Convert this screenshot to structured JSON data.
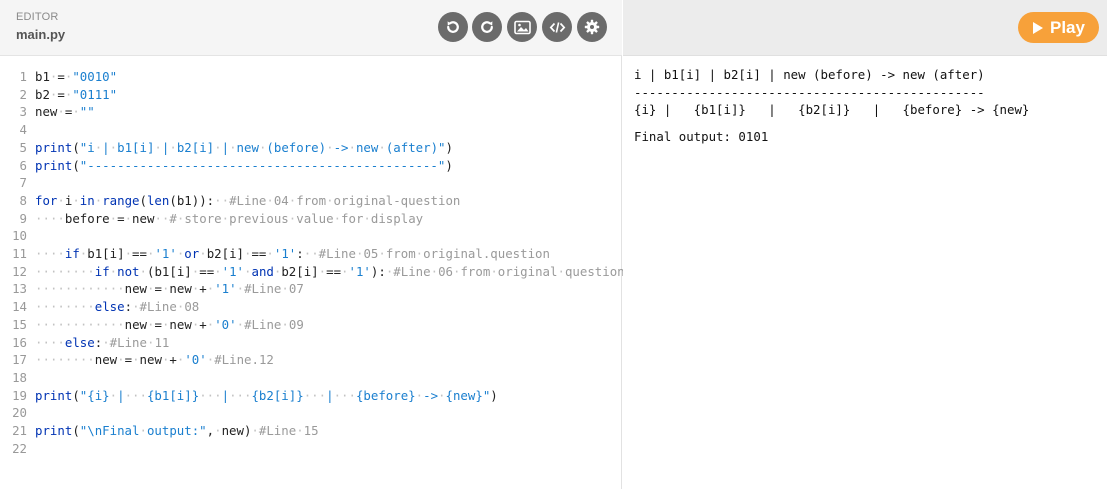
{
  "editor": {
    "label": "EDITOR",
    "file_name": "main.py",
    "toolbar": {
      "buttons": [
        {
          "name": "reset-button",
          "icon": "reset-icon"
        },
        {
          "name": "refresh-button",
          "icon": "refresh-icon"
        },
        {
          "name": "image-button",
          "icon": "image-icon"
        },
        {
          "name": "embed-button",
          "icon": "code-icon"
        },
        {
          "name": "settings-button",
          "icon": "gear-icon"
        }
      ],
      "button_color": "#6b6b6b"
    },
    "lines": [
      {
        "n": "1",
        "text": "b1 = \"0010\""
      },
      {
        "n": "2",
        "text": "b2 = \"0111\""
      },
      {
        "n": "3",
        "text": "new = \"\""
      },
      {
        "n": "4",
        "text": ""
      },
      {
        "n": "5",
        "text": "print(\"i | b1[i] | b2[i] | new (before) -> new (after)\")"
      },
      {
        "n": "6",
        "text": "print(\"-----------------------------------------------\")"
      },
      {
        "n": "7",
        "text": ""
      },
      {
        "n": "8",
        "text": "for i in range(len(b1)):  #Line 04 from original-question"
      },
      {
        "n": "9",
        "text": "    before = new  # store previous value for display"
      },
      {
        "n": "10",
        "text": ""
      },
      {
        "n": "11",
        "text": "    if b1[i] == '1' or b2[i] == '1':  #Line 05 from original.question"
      },
      {
        "n": "12",
        "text": "        if not (b1[i] == '1' and b2[i] == '1'): #Line 06 from original question"
      },
      {
        "n": "13",
        "text": "            new = new + '1' #Line 07"
      },
      {
        "n": "14",
        "text": "        else: #Line 08"
      },
      {
        "n": "15",
        "text": "            new = new + '0' #Line 09"
      },
      {
        "n": "16",
        "text": "    else: #Line 11"
      },
      {
        "n": "17",
        "text": "        new = new + '0' #Line.12"
      },
      {
        "n": "18",
        "text": ""
      },
      {
        "n": "19",
        "text": "print(\"{i} |   {b1[i]}   |   {b2[i]}   |   {before} -> {new}\")"
      },
      {
        "n": "20",
        "text": ""
      },
      {
        "n": "21",
        "text": "print(\"\\nFinal output:\", new) #Line 15"
      },
      {
        "n": "22",
        "text": ""
      }
    ]
  },
  "run": {
    "play_label": "Play",
    "play_color": "#f7a13a"
  },
  "output": {
    "lines": [
      "i | b1[i] | b2[i] | new (before) -> new (after)",
      "-----------------------------------------------",
      "{i} |   {b1[i]}   |   {b2[i]}   |   {before} -> {new}",
      "",
      "Final output: 0101"
    ]
  }
}
